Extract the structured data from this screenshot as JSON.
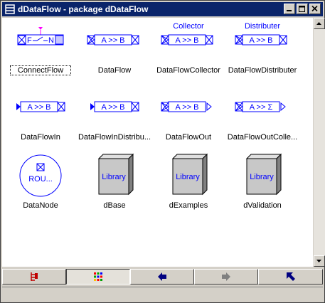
{
  "window": {
    "title": "dDataFlow - package dDataFlow"
  },
  "colors": {
    "titlebar": "#0a246a",
    "icon_blue": "#0000ff",
    "connector_magenta": "#ff00ff",
    "library_gray": "#c0c0c0"
  },
  "items": [
    {
      "label": "ConnectFlow",
      "icon": "connectflow-icon",
      "inner": "F ⌐ N"
    },
    {
      "label": "DataFlow",
      "icon": "dataflow-icon",
      "inner": "A >> B"
    },
    {
      "label": "DataFlowCollector",
      "icon": "dataflow-collector-icon",
      "inner": "A >> B",
      "caption": "Collector"
    },
    {
      "label": "DataFlowDistributer",
      "icon": "dataflow-distributer-icon",
      "inner": "A >> B",
      "caption": "Distributer"
    },
    {
      "label": "DataFlowIn",
      "icon": "dataflow-in-icon",
      "inner": "A >> B"
    },
    {
      "label": "DataFlowInDistribu...",
      "icon": "dataflow-in-distributer-icon",
      "inner": "A >> B"
    },
    {
      "label": "DataFlowOut",
      "icon": "dataflow-out-icon",
      "inner": "A >> B"
    },
    {
      "label": "DataFlowOutColle...",
      "icon": "dataflow-out-collector-icon",
      "inner": "A >> Σ"
    },
    {
      "label": "DataNode",
      "icon": "datanode-icon",
      "inner": "ROU..."
    },
    {
      "label": "dBase",
      "icon": "library-icon",
      "inner": "Library"
    },
    {
      "label": "dExamples",
      "icon": "library-icon",
      "inner": "Library"
    },
    {
      "label": "dValidation",
      "icon": "library-icon",
      "inner": "Library"
    }
  ],
  "tabs": [
    {
      "name": "tree-view-icon"
    },
    {
      "name": "icon-view-icon",
      "active": true
    },
    {
      "name": "back-arrow-icon"
    },
    {
      "name": "forward-arrow-icon"
    },
    {
      "name": "up-arrow-icon"
    }
  ]
}
